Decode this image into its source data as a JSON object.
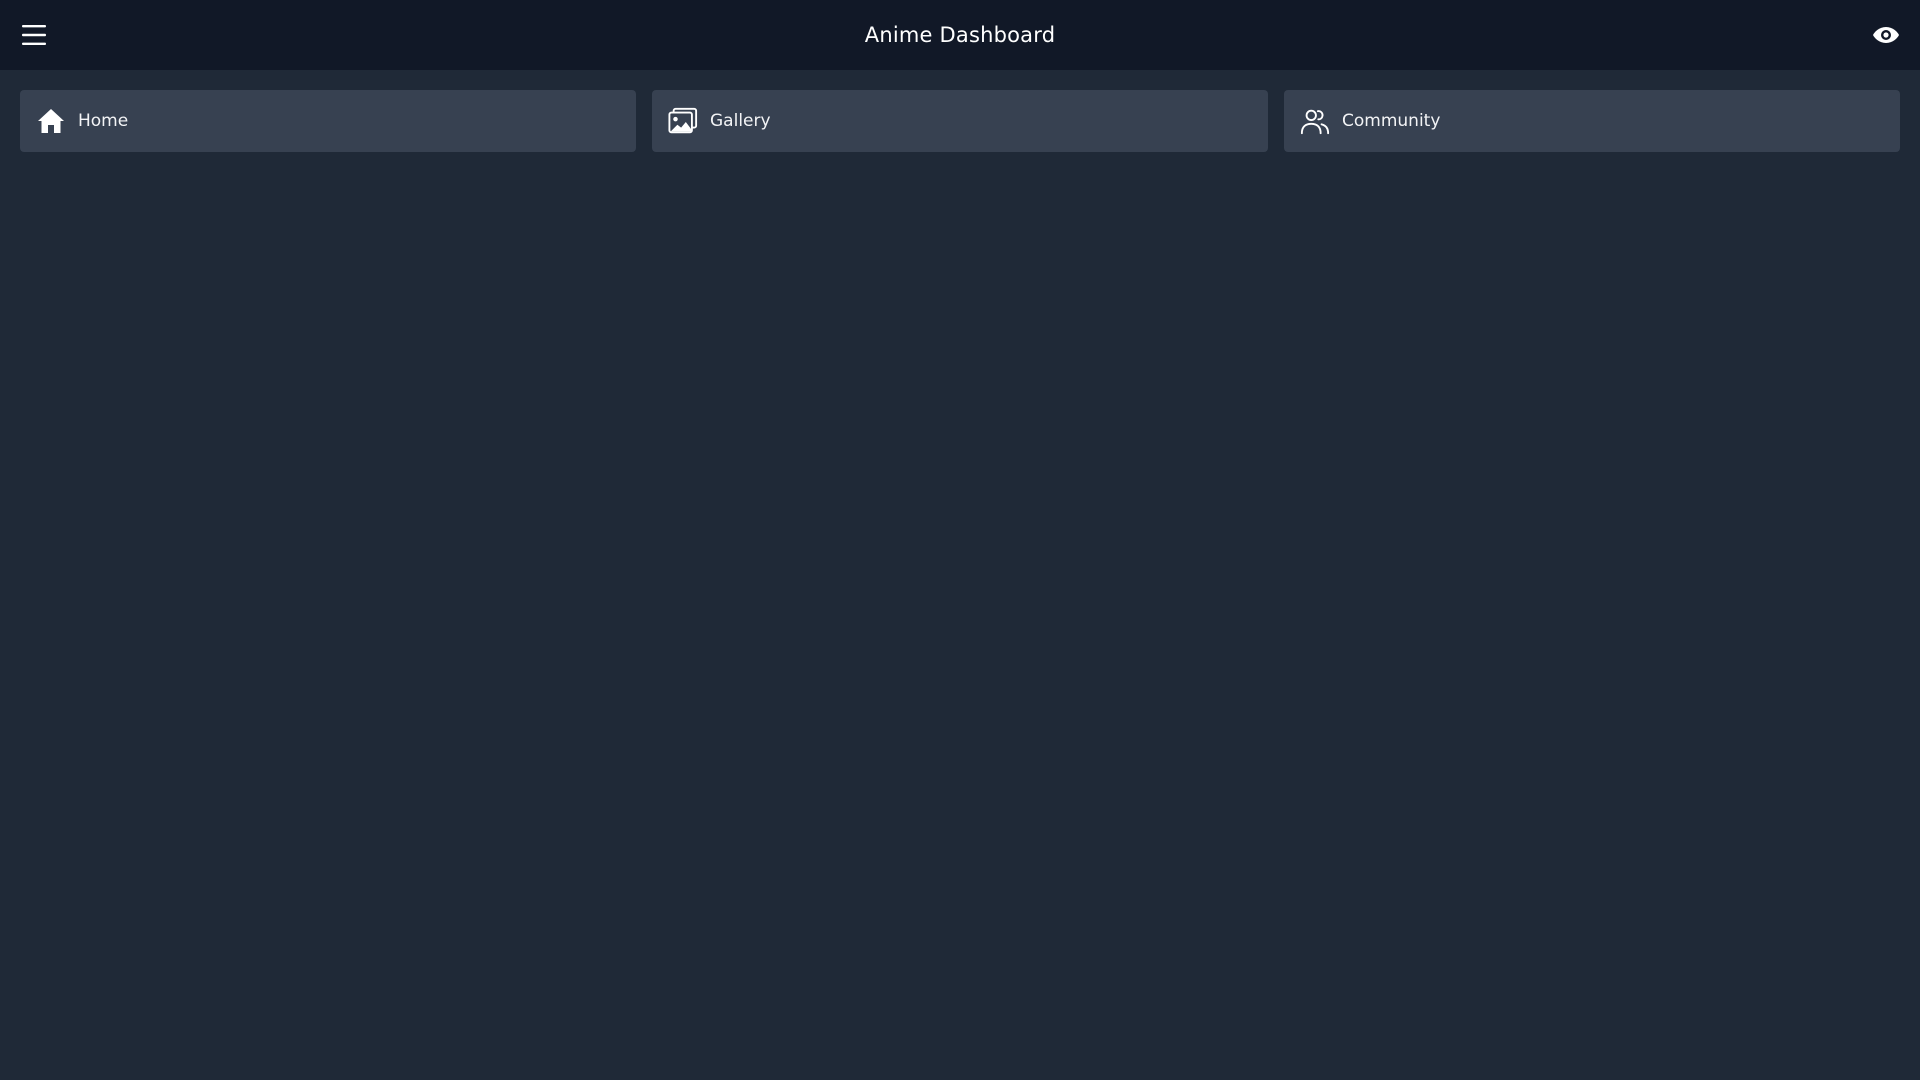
{
  "header": {
    "title": "Anime Dashboard",
    "menu_icon": "hamburger-menu-icon",
    "right_icon": "eye-icon"
  },
  "nav": {
    "items": [
      {
        "label": "Home",
        "icon": "home-icon"
      },
      {
        "label": "Gallery",
        "icon": "gallery-icon"
      },
      {
        "label": "Community",
        "icon": "community-icon"
      }
    ]
  },
  "colors": {
    "background": "#1f2937",
    "header_background": "#111827",
    "card_background": "#374151",
    "text": "#ffffff"
  }
}
